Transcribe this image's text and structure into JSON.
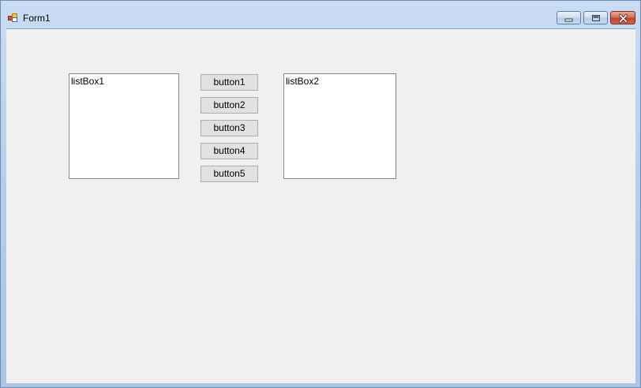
{
  "window": {
    "title": "Form1",
    "icon": "form-app-icon",
    "controls": {
      "minimize": "minimize-icon",
      "maximize": "maximize-icon",
      "close": "close-icon"
    }
  },
  "form": {
    "listbox1": {
      "label": "listBox1"
    },
    "listbox2": {
      "label": "listBox2"
    },
    "buttons": [
      {
        "label": "button1"
      },
      {
        "label": "button2"
      },
      {
        "label": "button3"
      },
      {
        "label": "button4"
      },
      {
        "label": "button5"
      }
    ]
  },
  "colors": {
    "client_background": "#f0f0f0",
    "button_face": "#e1e1e1",
    "listbox_background": "#ffffff",
    "close_button": "#c2432b"
  }
}
